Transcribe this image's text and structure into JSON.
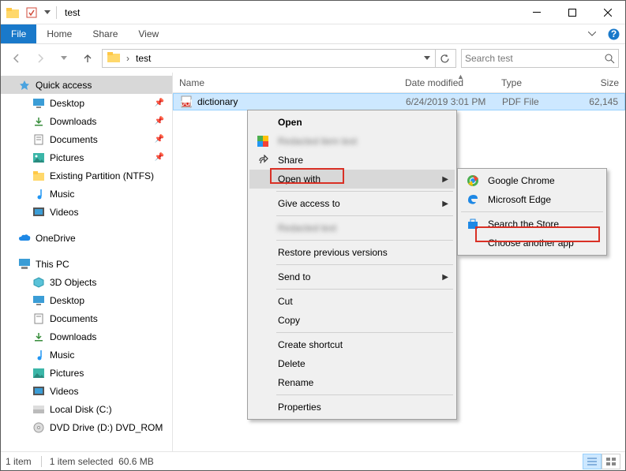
{
  "title": "test",
  "ribbon": {
    "file": "File",
    "home": "Home",
    "share": "Share",
    "view": "View"
  },
  "breadcrumb": {
    "item": "test"
  },
  "search": {
    "placeholder": "Search test"
  },
  "columns": {
    "name": "Name",
    "date": "Date modified",
    "type": "Type",
    "size": "Size"
  },
  "file_row": {
    "name": "dictionary",
    "date": "6/24/2019 3:01 PM",
    "type": "PDF File",
    "size": "62,145"
  },
  "sidebar": {
    "quick_access": "Quick access",
    "desktop": "Desktop",
    "downloads": "Downloads",
    "documents": "Documents",
    "pictures": "Pictures",
    "existing_partition": "Existing Partition (NTFS)",
    "music": "Music",
    "videos": "Videos",
    "onedrive": "OneDrive",
    "this_pc": "This PC",
    "objects3d": "3D Objects",
    "desktop2": "Desktop",
    "documents2": "Documents",
    "downloads2": "Downloads",
    "music2": "Music",
    "pictures2": "Pictures",
    "videos2": "Videos",
    "local_disk": "Local Disk (C:)",
    "dvd": "DVD Drive (D:) DVD_ROM"
  },
  "ctx": {
    "open": "Open",
    "share": "Share",
    "open_with": "Open with",
    "give_access": "Give access to",
    "restore": "Restore previous versions",
    "send_to": "Send to",
    "cut": "Cut",
    "copy": "Copy",
    "shortcut": "Create shortcut",
    "delete": "Delete",
    "rename": "Rename",
    "properties": "Properties"
  },
  "sub": {
    "chrome": "Google Chrome",
    "edge": "Microsoft Edge",
    "store": "Search the Store",
    "choose": "Choose another app"
  },
  "status": {
    "count": "1 item",
    "selected": "1 item selected",
    "size": "60.6 MB"
  }
}
